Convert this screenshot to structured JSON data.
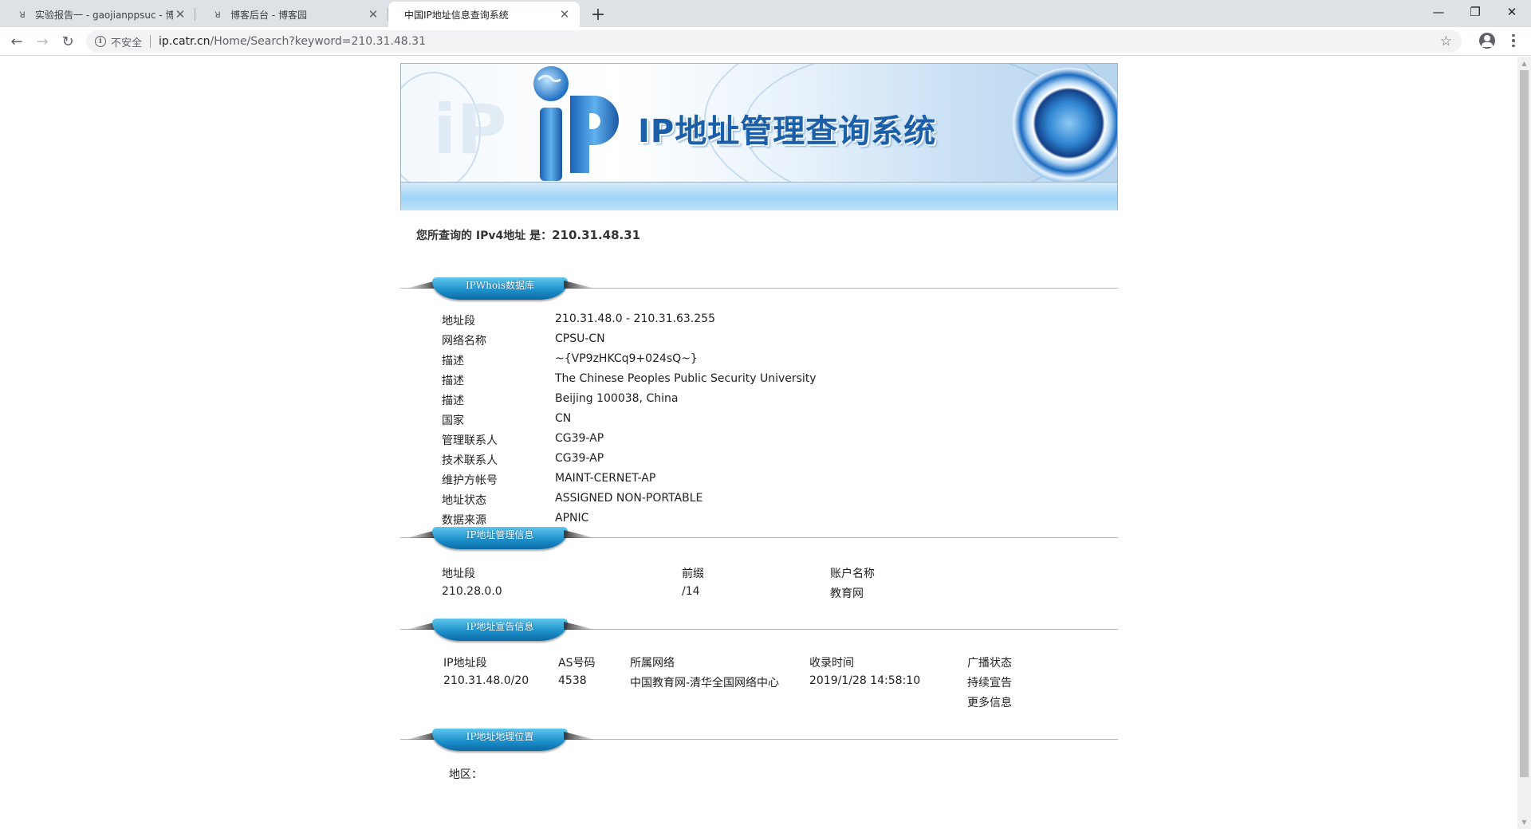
{
  "browser": {
    "tabs": [
      {
        "title": "实验报告一 - gaojianppsuc - 博",
        "favicon": "cnblogs-icon"
      },
      {
        "title": "博客后台 - 博客园",
        "favicon": "cnblogs-icon"
      },
      {
        "title": "中国IP地址信息查询系统",
        "favicon": "page-icon"
      }
    ],
    "new_tab": "+",
    "security_label": "不安全",
    "url_host": "ip.catr.cn",
    "url_path": "/Home/Search?keyword=210.31.48.31"
  },
  "banner": {
    "title": "IP地址管理查询系统"
  },
  "query": {
    "prefix": "您所查询的 IPv4地址 是：",
    "ip": "210.31.48.31"
  },
  "whois": {
    "section_label": "IPWhois数据库",
    "rows": [
      {
        "key": "地址段",
        "value": "210.31.48.0 - 210.31.63.255"
      },
      {
        "key": "网络名称",
        "value": "CPSU-CN"
      },
      {
        "key": "描述",
        "value": "~{VP9zHKCq9+024sQ~}"
      },
      {
        "key": "描述",
        "value": "The Chinese Peoples Public Security University"
      },
      {
        "key": "描述",
        "value": "Beijing 100038, China"
      },
      {
        "key": "国家",
        "value": "CN"
      },
      {
        "key": "管理联系人",
        "value": "CG39-AP"
      },
      {
        "key": "技术联系人",
        "value": "CG39-AP"
      },
      {
        "key": "维护方帐号",
        "value": "MAINT-CERNET-AP"
      },
      {
        "key": "地址状态",
        "value": "ASSIGNED NON-PORTABLE"
      },
      {
        "key": "数据来源",
        "value": "APNIC"
      }
    ]
  },
  "management": {
    "section_label": "IP地址管理信息",
    "headers": [
      "地址段",
      "前缀",
      "账户名称"
    ],
    "row": [
      "210.28.0.0",
      "/14",
      "教育网"
    ]
  },
  "announcement": {
    "section_label": "IP地址宣告信息",
    "headers": [
      "IP地址段",
      "AS号码",
      "所属网络",
      "收录时间",
      "广播状态"
    ],
    "row": [
      "210.31.48.0/20",
      "4538",
      "中国教育网-清华全国网络中心",
      "2019/1/28 14:58:10",
      "持续宣告"
    ],
    "more_link": "更多信息"
  },
  "geo": {
    "section_label": "IP地址地理位置",
    "region_label": "地区："
  }
}
